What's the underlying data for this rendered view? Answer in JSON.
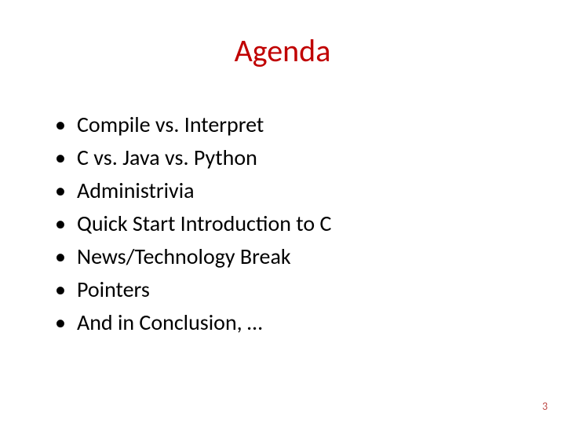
{
  "title": "Agenda",
  "bullets": {
    "marker": "•",
    "items": [
      "Compile vs. Interpret",
      "C vs. Java vs. Python",
      "Administrivia",
      "Quick Start Introduction to C",
      "News/Technology Break",
      "Pointers",
      "And in Conclusion, …"
    ]
  },
  "page_number": "3"
}
